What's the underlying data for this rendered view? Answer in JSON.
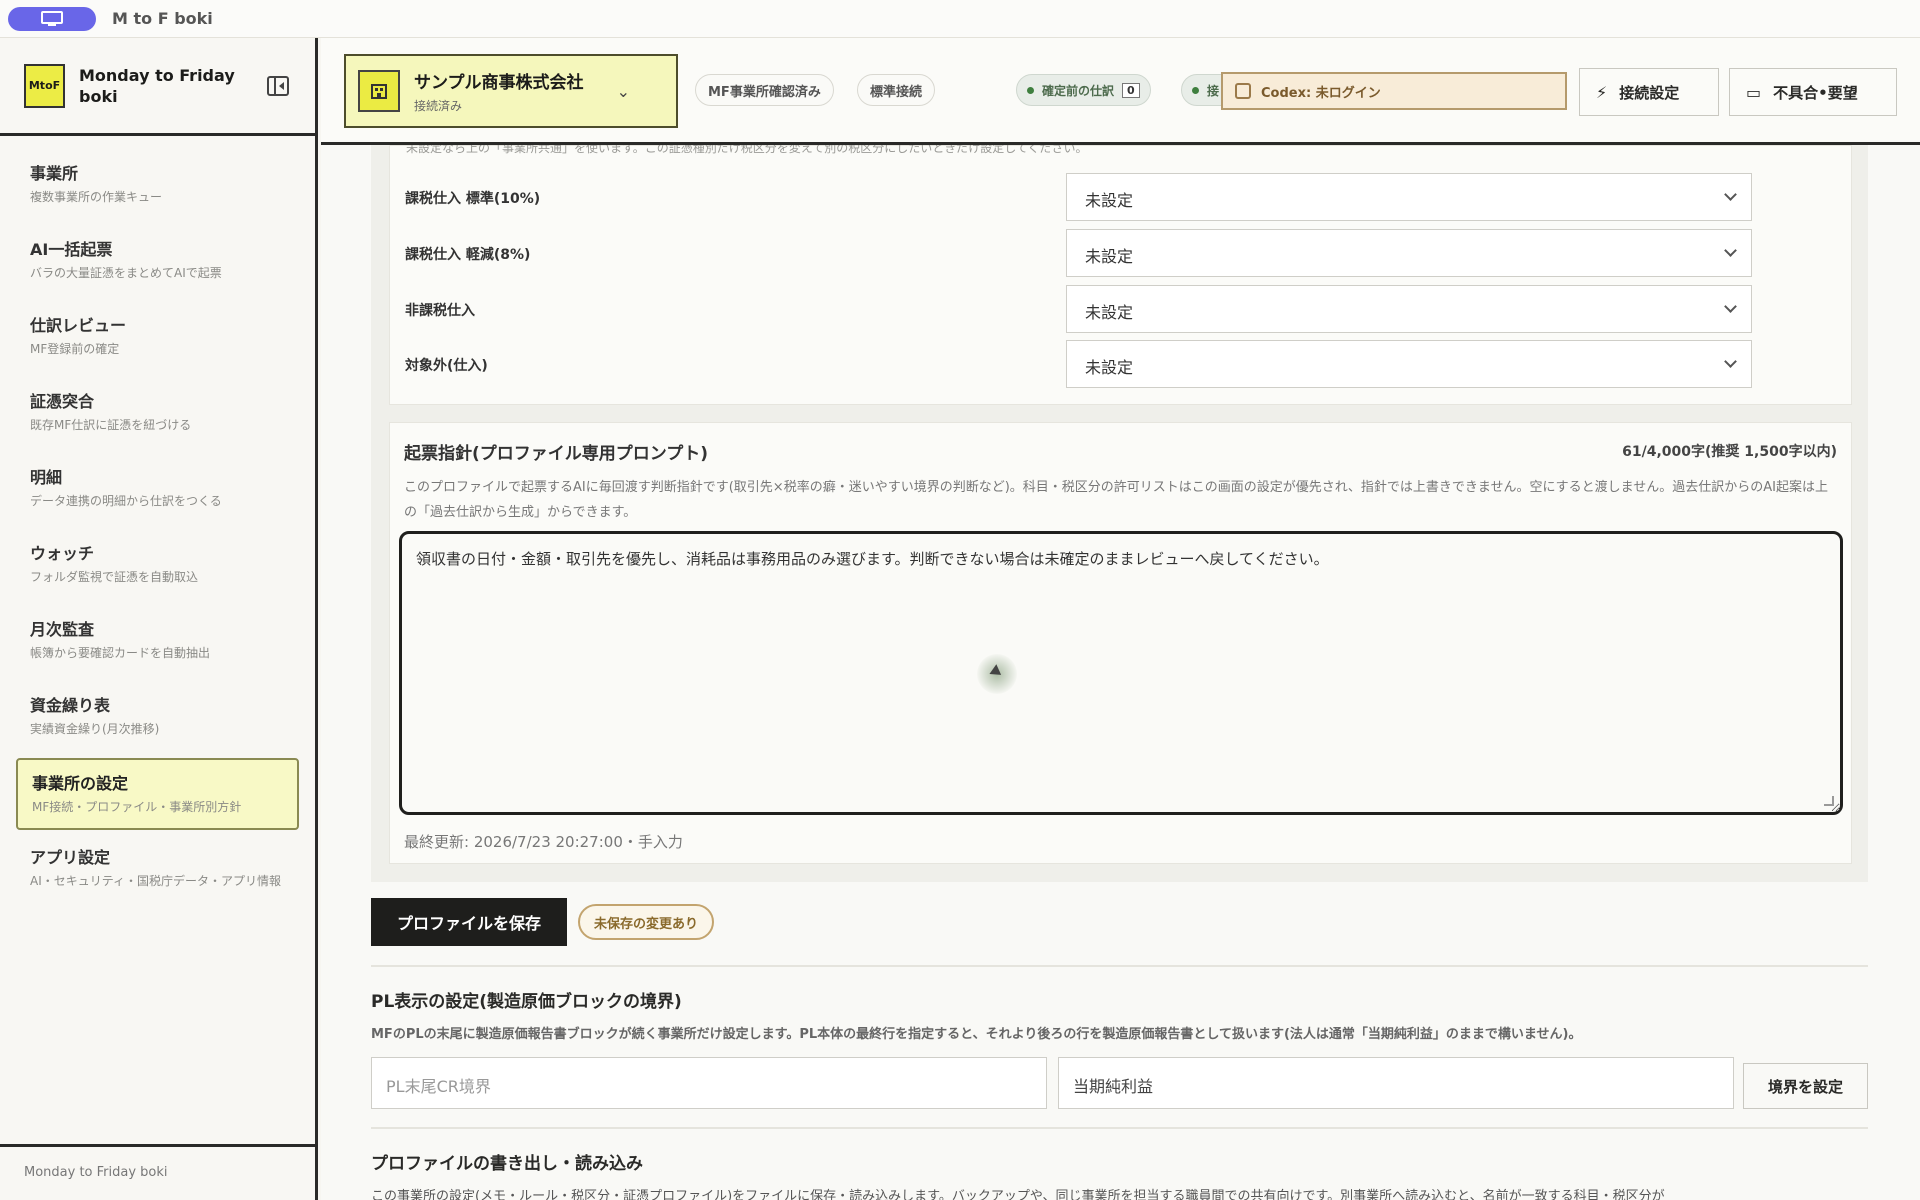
{
  "window": {
    "title": "M to F boki"
  },
  "brand": {
    "logo": "MtoF",
    "name": "Monday to Friday boki"
  },
  "sidebar": {
    "items": [
      {
        "label": "事業所",
        "desc": "複数事業所の作業キュー"
      },
      {
        "label": "AI一括起票",
        "desc": "バラの大量証憑をまとめてAIで起票"
      },
      {
        "label": "仕訳レビュー",
        "desc": "MF登録前の確定"
      },
      {
        "label": "証憑突合",
        "desc": "既存MF仕訳に証憑を紐づける"
      },
      {
        "label": "明細",
        "desc": "データ連携の明細から仕訳をつくる"
      },
      {
        "label": "ウォッチ",
        "desc": "フォルダ監視で証憑を自動取込"
      },
      {
        "label": "月次監査",
        "desc": "帳簿から要確認カードを自動抽出"
      },
      {
        "label": "資金繰り表",
        "desc": "実績資金繰り(月次推移)"
      },
      {
        "label": "事業所の設定",
        "desc": "MF接続・プロファイル・事業所別方針",
        "active": true
      },
      {
        "label": "アプリ設定",
        "desc": "AI・セキュリティ・国税庁データ・アプリ情報"
      }
    ],
    "footer": "Monday to Friday boki"
  },
  "topbar": {
    "company_name": "サンプル商事株式会社",
    "company_status": "接続済み",
    "tags": [
      "MF事業所確認済み",
      "標準接続"
    ],
    "pending_label": "確定前の仕訳",
    "pending_count": "0",
    "second_pill": "接",
    "codex_label": "Codex: 未ログイン",
    "connection_btn": "接続設定",
    "feedback_btn": "不具合•要望"
  },
  "mapping": {
    "note": "未設定なら上の「事業所共通」を使います。この証憑種別だけ税区分を変えて別の税区分にしたいときだけ設定してください。",
    "rows": [
      {
        "label": "課税仕入 標準(10%)",
        "value": "未設定"
      },
      {
        "label": "課税仕入 軽減(8%)",
        "value": "未設定"
      },
      {
        "label": "非課税仕入",
        "value": "未設定"
      },
      {
        "label": "対象外(仕入)",
        "value": "未設定"
      }
    ]
  },
  "prompt": {
    "title": "起票指針(プロファイル専用プロンプト)",
    "count": "61/4,000字(推奨 1,500字以内)",
    "desc": "このプロファイルで起票するAIに毎回渡す判断指針です(取引先×税率の癖・迷いやすい境界の判断など)。科目・税区分の許可リストはこの画面の設定が優先され、指針では上書きできません。空にすると渡しません。過去仕訳からのAI起案は上の「過去仕訳から生成」からできます。",
    "text": "領収書の日付・金額・取引先を優先し、消耗品は事務用品のみ選びます。判断できない場合は未確定のままレビューへ戻してください。",
    "updated": "最終更新: 2026/7/23 20:27:00・手入力"
  },
  "actions": {
    "save": "プロファイルを保存",
    "unsaved": "未保存の変更あり"
  },
  "pl": {
    "title": "PL表示の設定(製造原価ブロックの境界)",
    "desc": "MFのPLの末尾に製造原価報告書ブロックが続く事業所だけ設定します。PL本体の最終行を指定すると、それより後ろの行を製造原価報告書として扱います(法人は通常「当期純利益」のままで構いません)。",
    "placeholder": "PL末尾CR境界",
    "value": "当期純利益",
    "button": "境界を設定"
  },
  "export": {
    "title": "プロファイルの書き出し・読み込み",
    "desc": "この事業所の設定(メモ・ルール・税区分・証憑プロファイル)をファイルに保存・読み込みします。バックアップや、同じ事業所を担当する職員間での共有向けです。別事業所へ読み込むと、名前が一致する科目・税区分が"
  }
}
